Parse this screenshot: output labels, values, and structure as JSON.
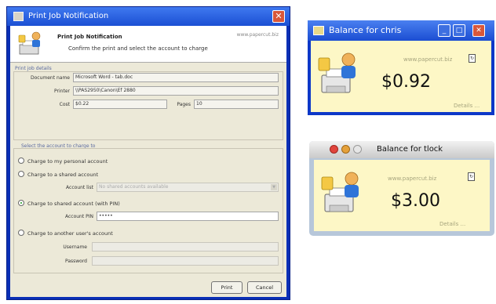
{
  "main_window": {
    "title": "Print Job Notification",
    "close_glyph": "✕",
    "header": {
      "title": "Print Job Notification",
      "subtitle": "Confirm the print and select the account to charge",
      "url": "www.papercut.biz"
    },
    "job_details": {
      "section_label": "Print job details",
      "document_name_label": "Document name",
      "document_name_value": "Microsoft Word - tab.doc",
      "printer_label": "Printer",
      "printer_value": "\\\\PAS2950\\Canon\\Ef 2880",
      "cost_label": "Cost",
      "cost_value": "$0.22",
      "pages_label": "Pages",
      "pages_value": "10"
    },
    "charge": {
      "section_label": "Select the account to charge to",
      "options": [
        "Charge to my personal account",
        "Charge to a shared account",
        "Charge to shared account (with PIN)",
        "Charge to another user's account"
      ],
      "selected_index": 2,
      "account_list_label": "Account list",
      "account_list_value": "No shared accounts available",
      "account_pin_label": "Account PIN",
      "account_pin_value": "•••••",
      "username_label": "Username",
      "password_label": "Password"
    },
    "buttons": {
      "print": "Print",
      "cancel": "Cancel"
    }
  },
  "balance_windows": [
    {
      "title": "Balance for chris",
      "url": "www.papercut.biz",
      "amount": "$0.92",
      "details_label": "Details ..."
    },
    {
      "title": "Balance for tlock",
      "url": "www.papercut.biz",
      "amount": "$3.00",
      "details_label": "Details ..."
    }
  ],
  "icons": [
    "window-icon",
    "close-icon",
    "minimize-icon",
    "maximize-icon",
    "printer-user-icon",
    "refresh-icon"
  ],
  "colors": {
    "xp_blue": "#0a2fb6",
    "window_face": "#ece9d8",
    "balance_bg": "#fdf7c6",
    "mac_close": "#e0443c",
    "mac_min": "#e5a13a"
  }
}
